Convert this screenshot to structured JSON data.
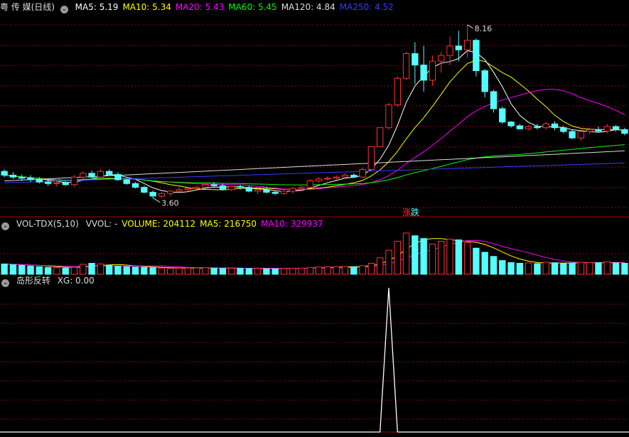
{
  "stock": {
    "title": "粤 传 媒(日线)"
  },
  "price_panel": {
    "indicators": [
      {
        "label": "MA5: 5.19",
        "color": "#ffffff"
      },
      {
        "label": "MA10: 5.34",
        "color": "#ffff00"
      },
      {
        "label": "MA20: 5.43",
        "color": "#ff00ff"
      },
      {
        "label": "MA60: 5.45",
        "color": "#00ff00"
      },
      {
        "label": "MA120: 4.84",
        "color": "#dddddd"
      },
      {
        "label": "MA250: 4.52",
        "color": "#3a3aff"
      }
    ],
    "high_label": "8.16",
    "low_label": "3.60",
    "badge": {
      "up": "涨",
      "down": "跌"
    }
  },
  "volume_panel": {
    "title": "VOL-TDX(5,10)",
    "indicators": [
      {
        "label": "VVOL: -",
        "color": "#dddddd"
      },
      {
        "label": "VOLUME: 204112",
        "color": "#ffff00"
      },
      {
        "label": "MA5: 216750",
        "color": "#ffff00"
      },
      {
        "label": "MA10: 329937",
        "color": "#ff00ff"
      }
    ]
  },
  "signal_panel": {
    "title": "岛形反转",
    "value_label": "XG: 0.00"
  },
  "colors": {
    "up": "#ff3232",
    "down": "#54ffff",
    "grid": "#8b0000",
    "background": "#000000"
  },
  "chart_data": {
    "type": "candlestick",
    "price_ylim": [
      3.2,
      8.4
    ],
    "ohlc": [
      [
        4.3,
        4.35,
        4.15,
        4.2
      ],
      [
        4.2,
        4.28,
        4.1,
        4.15
      ],
      [
        4.15,
        4.22,
        4.05,
        4.12
      ],
      [
        4.12,
        4.2,
        4.02,
        4.08
      ],
      [
        4.08,
        4.15,
        3.98,
        4.02
      ],
      [
        4.02,
        4.1,
        3.92,
        3.98
      ],
      [
        3.98,
        4.06,
        3.9,
        4.0
      ],
      [
        4.0,
        4.05,
        3.92,
        3.95
      ],
      [
        3.95,
        4.2,
        3.9,
        4.15
      ],
      [
        4.15,
        4.3,
        4.1,
        4.25
      ],
      [
        4.25,
        4.32,
        4.12,
        4.15
      ],
      [
        4.15,
        4.35,
        4.1,
        4.3
      ],
      [
        4.3,
        4.35,
        4.18,
        4.22
      ],
      [
        4.22,
        4.28,
        4.05,
        4.08
      ],
      [
        4.08,
        4.12,
        3.95,
        3.98
      ],
      [
        3.98,
        4.02,
        3.85,
        3.88
      ],
      [
        3.88,
        3.92,
        3.72,
        3.75
      ],
      [
        3.75,
        3.8,
        3.6,
        3.65
      ],
      [
        3.65,
        3.75,
        3.6,
        3.72
      ],
      [
        3.72,
        3.82,
        3.65,
        3.78
      ],
      [
        3.78,
        3.88,
        3.72,
        3.82
      ],
      [
        3.82,
        3.9,
        3.78,
        3.85
      ],
      [
        3.85,
        3.92,
        3.8,
        3.88
      ],
      [
        3.88,
        3.98,
        3.85,
        3.95
      ],
      [
        3.95,
        4.02,
        3.88,
        3.92
      ],
      [
        3.92,
        3.98,
        3.8,
        3.82
      ],
      [
        3.82,
        3.92,
        3.78,
        3.9
      ],
      [
        3.9,
        3.95,
        3.82,
        3.88
      ],
      [
        3.88,
        3.92,
        3.75,
        3.78
      ],
      [
        3.78,
        3.85,
        3.7,
        3.82
      ],
      [
        3.82,
        3.88,
        3.72,
        3.75
      ],
      [
        3.75,
        3.8,
        3.68,
        3.72
      ],
      [
        3.72,
        3.82,
        3.68,
        3.78
      ],
      [
        3.78,
        3.88,
        3.72,
        3.85
      ],
      [
        3.85,
        3.92,
        3.78,
        3.88
      ],
      [
        3.88,
        4.1,
        3.85,
        4.05
      ],
      [
        4.05,
        4.15,
        4.0,
        4.1
      ],
      [
        4.1,
        4.18,
        4.05,
        4.12
      ],
      [
        4.12,
        4.2,
        4.08,
        4.15
      ],
      [
        4.15,
        4.25,
        4.1,
        4.2
      ],
      [
        4.2,
        4.25,
        4.12,
        4.15
      ],
      [
        4.15,
        4.4,
        4.12,
        4.35
      ],
      [
        4.35,
        4.95,
        4.3,
        4.95
      ],
      [
        4.95,
        5.45,
        4.95,
        5.45
      ],
      [
        5.45,
        6.1,
        5.4,
        6.05
      ],
      [
        6.05,
        6.8,
        6.0,
        6.75
      ],
      [
        6.75,
        7.45,
        6.7,
        7.4
      ],
      [
        7.4,
        7.7,
        6.6,
        7.1
      ],
      [
        7.1,
        7.6,
        6.4,
        6.7
      ],
      [
        6.7,
        7.35,
        6.55,
        7.2
      ],
      [
        7.2,
        7.45,
        6.9,
        7.35
      ],
      [
        7.35,
        7.85,
        7.1,
        7.6
      ],
      [
        7.6,
        8.0,
        7.2,
        7.5
      ],
      [
        7.5,
        8.16,
        7.3,
        7.75
      ],
      [
        7.75,
        7.8,
        6.8,
        6.95
      ],
      [
        6.95,
        7.0,
        6.25,
        6.4
      ],
      [
        6.4,
        6.45,
        5.85,
        5.95
      ],
      [
        5.95,
        6.0,
        5.55,
        5.6
      ],
      [
        5.6,
        5.62,
        5.45,
        5.5
      ],
      [
        5.5,
        5.55,
        5.4,
        5.42
      ],
      [
        5.42,
        5.52,
        5.38,
        5.48
      ],
      [
        5.48,
        5.55,
        5.4,
        5.45
      ],
      [
        5.45,
        5.6,
        5.4,
        5.55
      ],
      [
        5.55,
        5.62,
        5.38,
        5.45
      ],
      [
        5.45,
        5.5,
        5.3,
        5.35
      ],
      [
        5.35,
        5.4,
        5.15,
        5.18
      ],
      [
        5.18,
        5.4,
        5.1,
        5.35
      ],
      [
        5.35,
        5.45,
        5.28,
        5.4
      ],
      [
        5.4,
        5.48,
        5.32,
        5.36
      ],
      [
        5.36,
        5.55,
        5.3,
        5.48
      ],
      [
        5.48,
        5.52,
        5.35,
        5.4
      ],
      [
        5.4,
        5.45,
        5.25,
        5.3
      ]
    ],
    "volume": [
      150,
      140,
      130,
      120,
      110,
      100,
      95,
      90,
      100,
      145,
      160,
      150,
      130,
      120,
      110,
      105,
      100,
      95,
      90,
      85,
      88,
      90,
      92,
      95,
      90,
      85,
      88,
      86,
      84,
      86,
      82,
      80,
      84,
      88,
      90,
      100,
      105,
      108,
      110,
      115,
      110,
      125,
      160,
      240,
      350,
      480,
      600,
      560,
      520,
      440,
      480,
      510,
      500,
      460,
      380,
      320,
      260,
      200,
      170,
      160,
      165,
      155,
      175,
      168,
      160,
      165,
      175,
      170,
      168,
      180,
      165,
      160
    ],
    "signal": {
      "index": 44,
      "value": 1
    }
  }
}
